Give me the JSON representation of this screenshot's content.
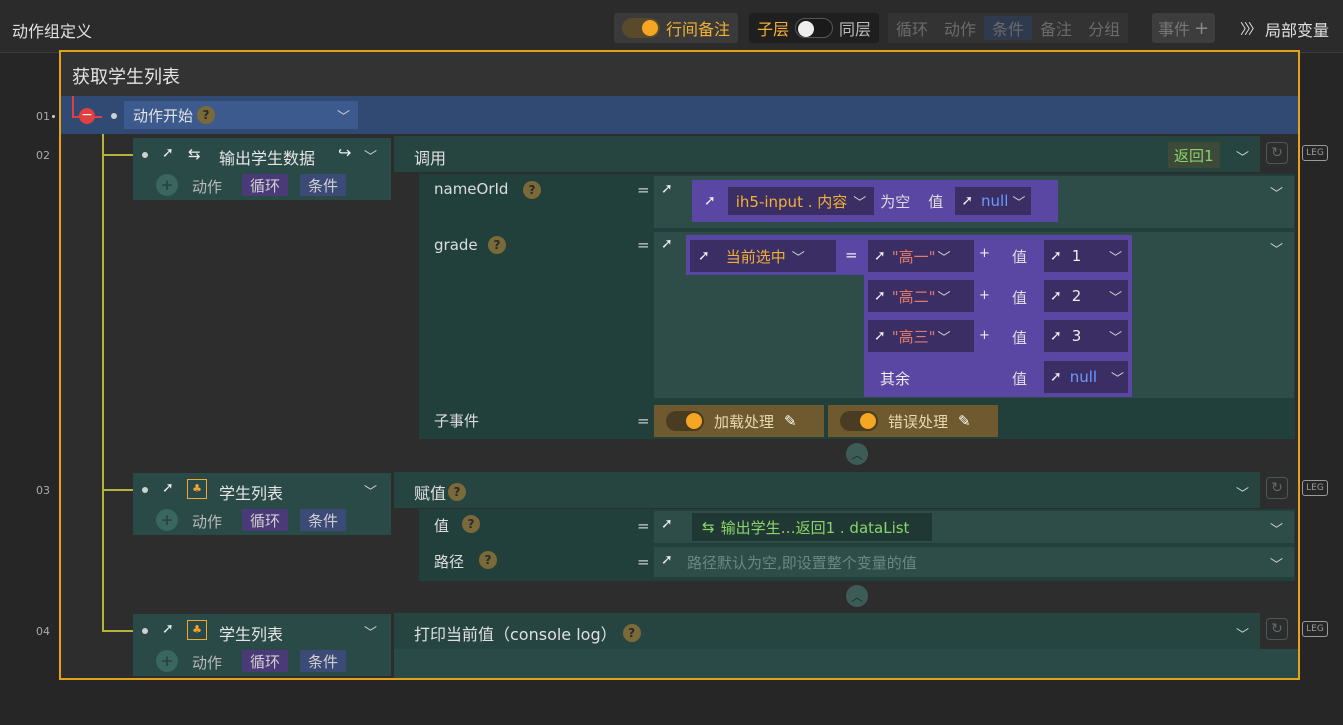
{
  "header": {
    "title": "动作组定义",
    "inline_note_label": "行间备注",
    "sublayer_label": "子层",
    "samelayer_label": "同层",
    "toolbar_items": [
      "循环",
      "动作",
      "条件",
      "备注",
      "分组"
    ],
    "event_label": "事件",
    "local_var_label": "局部变量"
  },
  "group_title": "获取学生列表",
  "rows": [
    {
      "num": "01",
      "title": "动作开始"
    },
    {
      "num": "02",
      "title": "输出学生数据",
      "type": "调用",
      "return_label": "返回1",
      "sub": [
        "动作",
        "循环",
        "条件"
      ]
    },
    {
      "num": "03",
      "title": "学生列表",
      "type": "赋值",
      "sub": [
        "动作",
        "循环",
        "条件"
      ]
    },
    {
      "num": "04",
      "title": "学生列表",
      "type": "打印当前值（console log）",
      "sub": [
        "动作",
        "循环",
        "条件"
      ]
    }
  ],
  "params": {
    "nameorid_label": "nameOrId",
    "nameorid_field": "ih5-input . 内容",
    "empty_label": "为空",
    "value_label": "值",
    "null_label": "null",
    "grade_label": "grade",
    "current_selected": "当前选中",
    "eq_label": "=",
    "cases": [
      {
        "match": "\"高一\"",
        "value": "1"
      },
      {
        "match": "\"高二\"",
        "value": "2"
      },
      {
        "match": "\"高三\"",
        "value": "3"
      }
    ],
    "else_label": "其余",
    "subevent_label": "子事件",
    "loading_label": "加载处理",
    "error_label": "错误处理",
    "assign_value_label": "值",
    "assign_value_expr": "输出学生…返回1 . dataList",
    "path_label": "路径",
    "path_placeholder": "路径默认为空,即设置整个变量的值"
  }
}
